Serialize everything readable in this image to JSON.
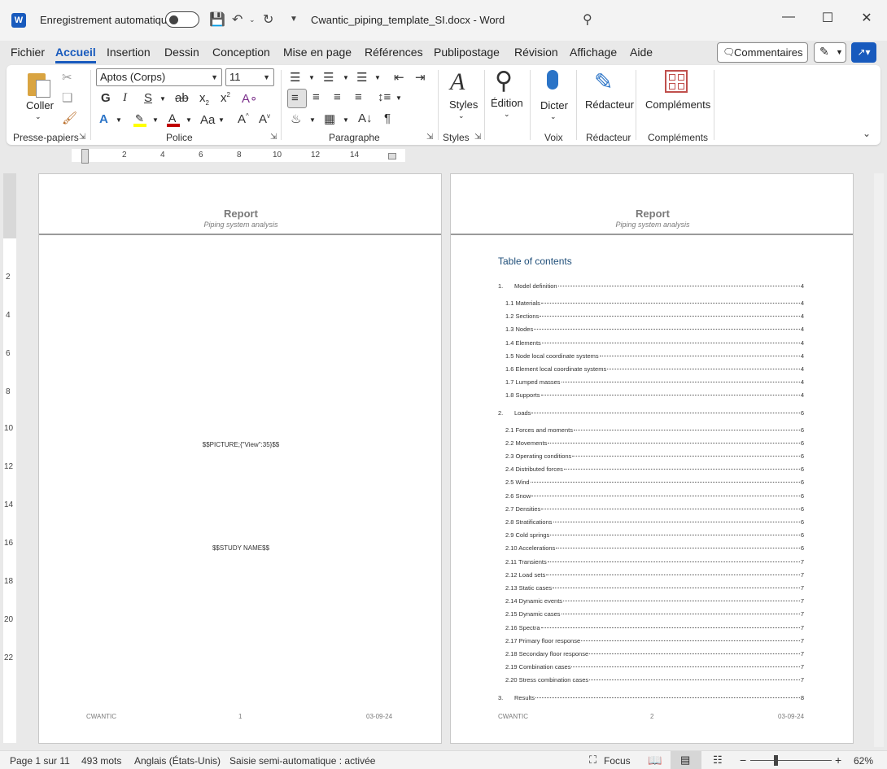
{
  "titlebar": {
    "autosave_label": "Enregistrement automatique",
    "doc_title": "Cwantic_piping_template_SI.docx  -  Word"
  },
  "menu": {
    "items": [
      "Fichier",
      "Accueil",
      "Insertion",
      "Dessin",
      "Conception",
      "Mise en page",
      "Références",
      "Publipostage",
      "Révision",
      "Affichage",
      "Aide"
    ],
    "comments": "Commentaires"
  },
  "ribbon": {
    "clipboard": {
      "paste": "Coller",
      "label": "Presse-papiers"
    },
    "font": {
      "name": "Aptos (Corps)",
      "size": "11",
      "label": "Police"
    },
    "paragraph": {
      "label": "Paragraphe"
    },
    "styles": {
      "button": "Styles",
      "label": "Styles"
    },
    "edition": {
      "button": "Édition"
    },
    "voice": {
      "button": "Dicter",
      "label": "Voix"
    },
    "editor": {
      "button": "Rédacteur",
      "label": "Rédacteur"
    },
    "addins": {
      "button": "Compléments",
      "label": "Compléments"
    }
  },
  "colors": {
    "accent": "#185abd",
    "highlight": "#ffff00",
    "font_color": "#c00000"
  },
  "ruler": {
    "h_numbers": [
      "2",
      "4",
      "6",
      "8",
      "10",
      "12",
      "14"
    ],
    "v_numbers": [
      "2",
      "4",
      "6",
      "8",
      "10",
      "12",
      "14",
      "16",
      "18",
      "20",
      "22"
    ]
  },
  "page1": {
    "header_title": "Report",
    "header_sub": "Piping system analysis",
    "picture_tag": "$$PICTURE;{\"View\":35}$$",
    "study_tag": "$$STUDY NAME$$",
    "footer_left": "CWANTIC",
    "footer_mid": "1",
    "footer_right": "03-09-24"
  },
  "page2": {
    "header_title": "Report",
    "header_sub": "Piping system analysis",
    "toc_heading": "Table of contents",
    "footer_left": "CWANTIC",
    "footer_mid": "2",
    "footer_right": "03-09-24"
  },
  "toc": [
    {
      "num": "1.",
      "label": "Model definition",
      "page": "4",
      "level": 1
    },
    {
      "num": "",
      "label": "1.1 Materials",
      "page": "4",
      "level": 2
    },
    {
      "num": "",
      "label": "1.2 Sections",
      "page": "4",
      "level": 2
    },
    {
      "num": "",
      "label": "1.3 Nodes",
      "page": "4",
      "level": 2
    },
    {
      "num": "",
      "label": "1.4 Elements",
      "page": "4",
      "level": 2
    },
    {
      "num": "",
      "label": "1.5 Node local coordinate systems",
      "page": "4",
      "level": 2
    },
    {
      "num": "",
      "label": "1.6 Element local coordinate systems",
      "page": "4",
      "level": 2
    },
    {
      "num": "",
      "label": "1.7 Lumped masses",
      "page": "4",
      "level": 2
    },
    {
      "num": "",
      "label": "1.8 Supports",
      "page": "4",
      "level": 2
    },
    {
      "num": "2.",
      "label": "Loads",
      "page": "6",
      "level": 1
    },
    {
      "num": "",
      "label": "2.1 Forces and moments",
      "page": "6",
      "level": 2
    },
    {
      "num": "",
      "label": "2.2 Movements",
      "page": "6",
      "level": 2
    },
    {
      "num": "",
      "label": "2.3 Operating conditions",
      "page": "6",
      "level": 2
    },
    {
      "num": "",
      "label": "2.4 Distributed forces",
      "page": "6",
      "level": 2
    },
    {
      "num": "",
      "label": "2.5 Wind",
      "page": "6",
      "level": 2
    },
    {
      "num": "",
      "label": "2.6 Snow",
      "page": "6",
      "level": 2
    },
    {
      "num": "",
      "label": "2.7 Densities",
      "page": "6",
      "level": 2
    },
    {
      "num": "",
      "label": "2.8 Stratifications",
      "page": "6",
      "level": 2
    },
    {
      "num": "",
      "label": "2.9 Cold springs",
      "page": "6",
      "level": 2
    },
    {
      "num": "",
      "label": "2.10 Accelerations",
      "page": "6",
      "level": 2
    },
    {
      "num": "",
      "label": "2.11 Transients",
      "page": "7",
      "level": 2
    },
    {
      "num": "",
      "label": "2.12 Load sets",
      "page": "7",
      "level": 2
    },
    {
      "num": "",
      "label": "2.13 Static cases",
      "page": "7",
      "level": 2
    },
    {
      "num": "",
      "label": "2.14 Dynamic events",
      "page": "7",
      "level": 2
    },
    {
      "num": "",
      "label": "2.15 Dynamic cases",
      "page": "7",
      "level": 2
    },
    {
      "num": "",
      "label": "2.16 Spectra",
      "page": "7",
      "level": 2
    },
    {
      "num": "",
      "label": "2.17 Primary floor response",
      "page": "7",
      "level": 2
    },
    {
      "num": "",
      "label": "2.18 Secondary floor response",
      "page": "7",
      "level": 2
    },
    {
      "num": "",
      "label": "2.19 Combination cases",
      "page": "7",
      "level": 2
    },
    {
      "num": "",
      "label": "2.20 Stress combination cases",
      "page": "7",
      "level": 2
    },
    {
      "num": "3.",
      "label": "Results",
      "page": "8",
      "level": 1
    }
  ],
  "status": {
    "page": "Page 1 sur 11",
    "words": "493 mots",
    "language": "Anglais (États-Unis)",
    "autocomplete": "Saisie semi-automatique : activée",
    "focus": "Focus",
    "zoom": "62%"
  }
}
